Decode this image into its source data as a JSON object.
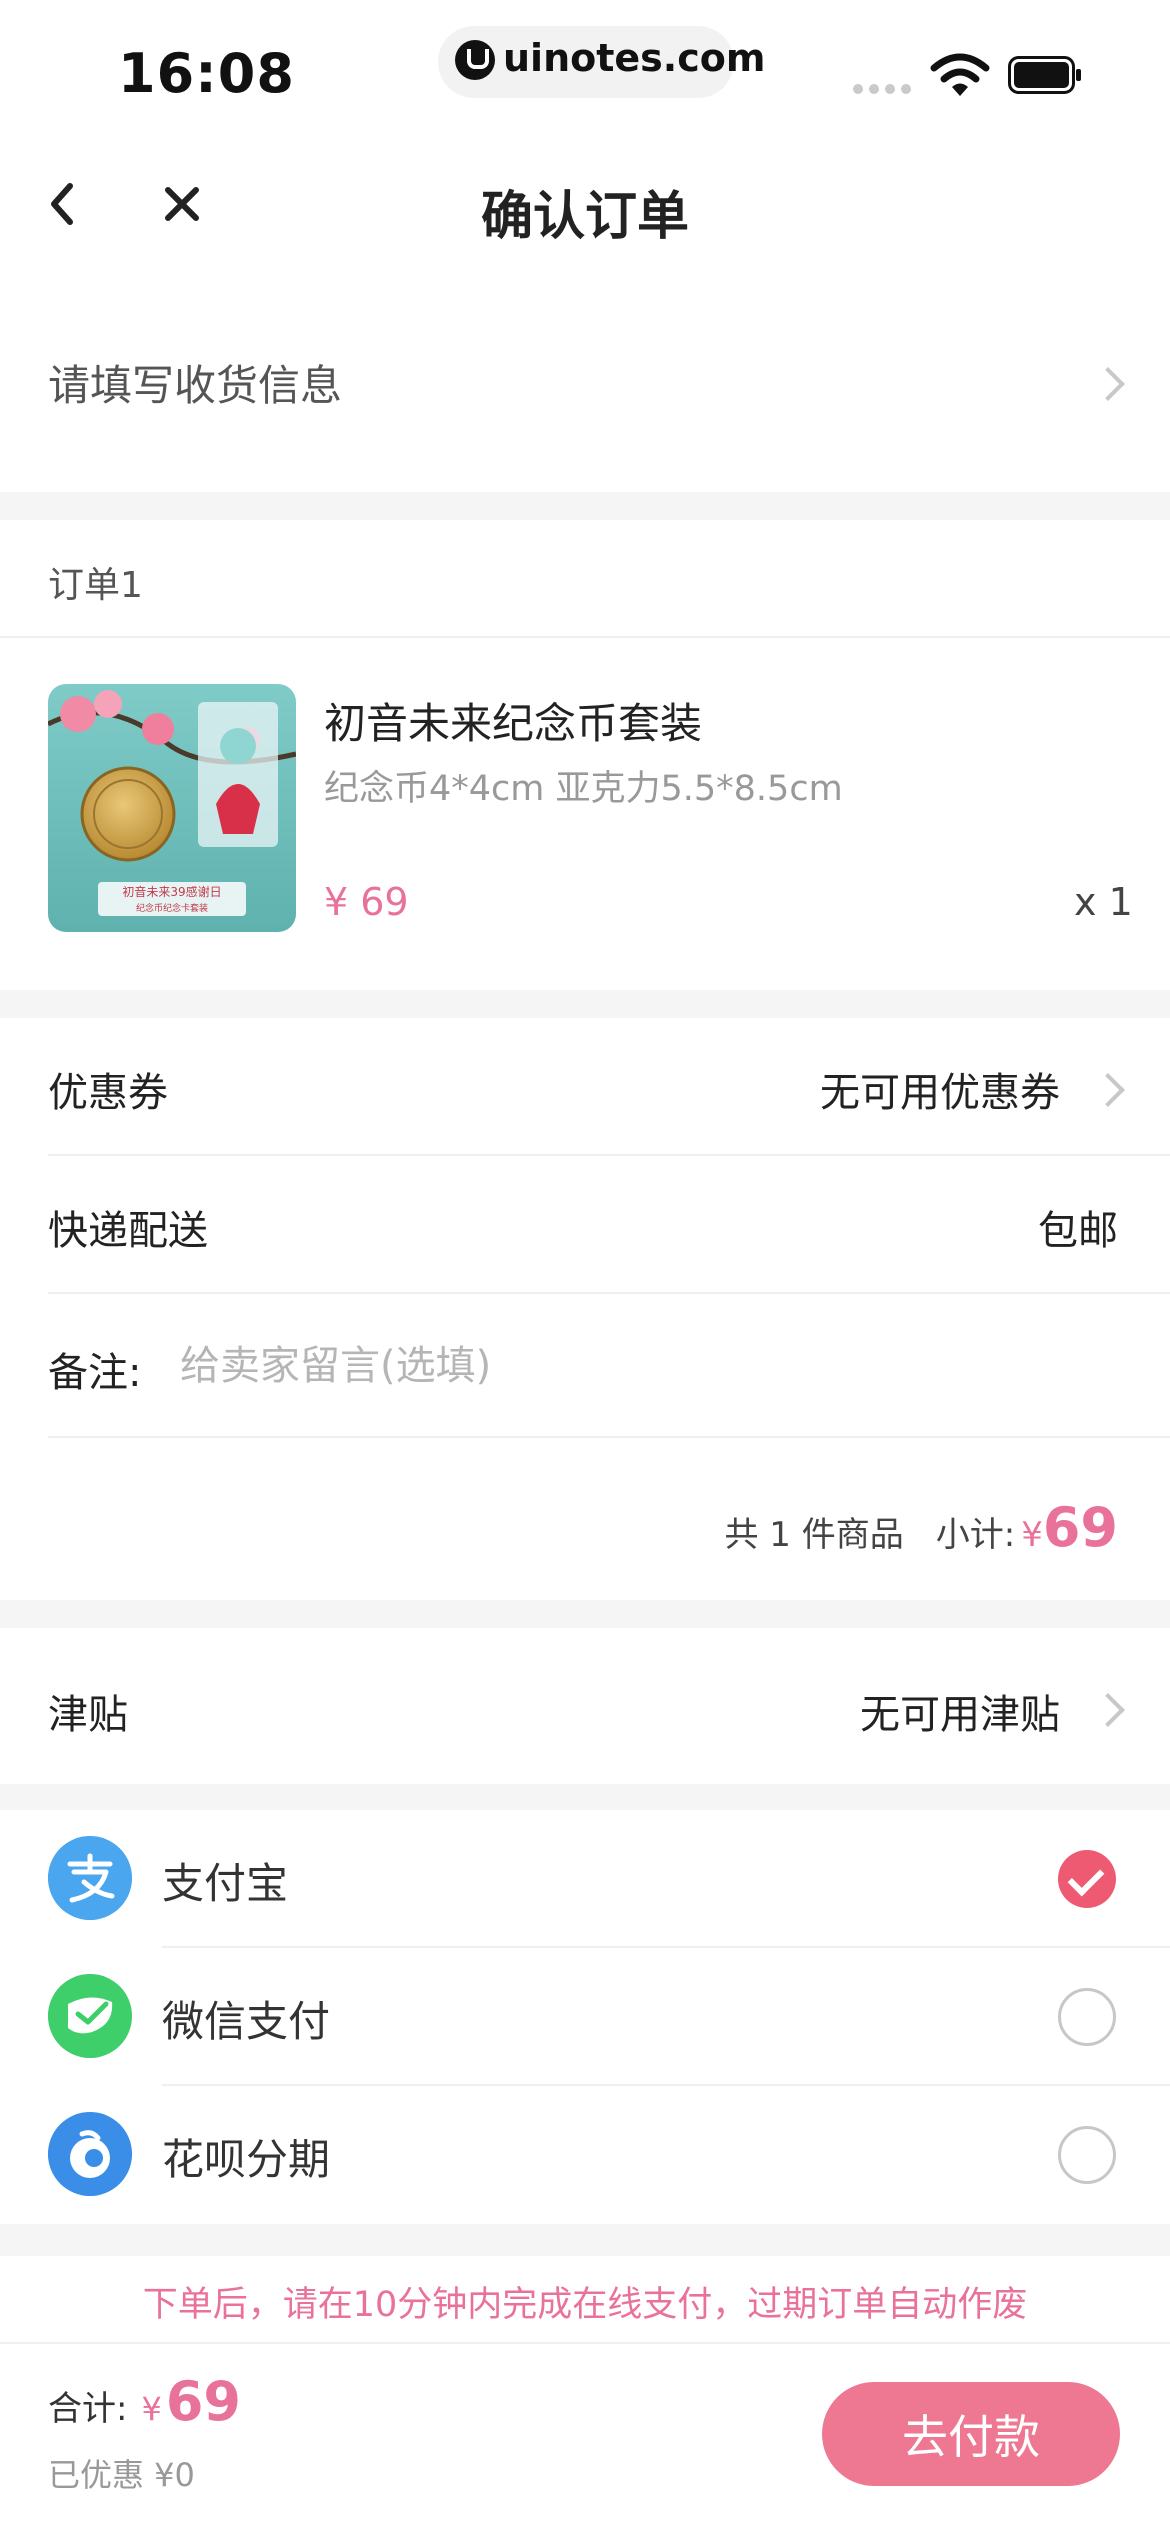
{
  "status_bar": {
    "time": "16:08",
    "url": "uinotes.com"
  },
  "nav": {
    "title": "确认订单"
  },
  "address": {
    "placeholder_text": "请填写收货信息"
  },
  "order": {
    "label": "订单1",
    "product": {
      "name": "初音未来纪念币套装",
      "spec": "纪念币4*4cm 亚克力5.5*8.5cm",
      "price": "¥ 69",
      "quantity": "x 1",
      "image_text_line1": "初音未来39感谢日",
      "image_text_line2": "纪念币纪念卡套装"
    }
  },
  "options": {
    "coupon_label": "优惠券",
    "coupon_value": "无可用优惠券",
    "shipping_label": "快递配送",
    "shipping_value": "包邮",
    "remark_label": "备注:",
    "remark_placeholder": "给卖家留言(选填)"
  },
  "summary": {
    "count_text": "共 1 件商品",
    "subtotal_label": "小计:",
    "currency": "¥",
    "amount": "69"
  },
  "subsidy": {
    "label": "津贴",
    "value": "无可用津贴"
  },
  "payment": {
    "methods": [
      {
        "label": "支付宝",
        "icon": "alipay-icon",
        "selected": true
      },
      {
        "label": "微信支付",
        "icon": "wechat-pay-icon",
        "selected": false
      },
      {
        "label": "花呗分期",
        "icon": "huabei-icon",
        "selected": false
      }
    ]
  },
  "footer": {
    "notice": "下单后，请在10分钟内完成在线支付，过期订单自动作废",
    "total_label": "合计:",
    "total_currency": "¥",
    "total_amount": "69",
    "discount_text": "已优惠 ¥0",
    "pay_button": "去付款"
  },
  "colors": {
    "accent": "#e9729a",
    "pay_button": "#ee7792",
    "alipay": "#4aa6ee",
    "wechat": "#3ecf6a",
    "huabei": "#3b8ee8",
    "checked": "#ef5a73"
  }
}
